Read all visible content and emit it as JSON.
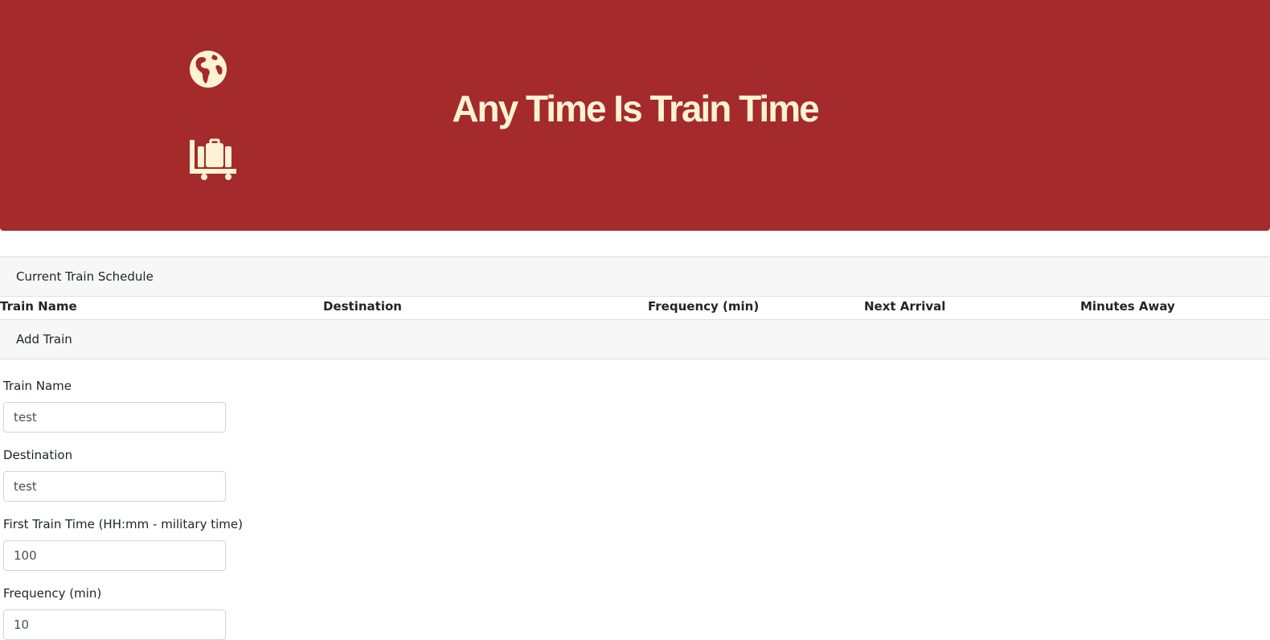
{
  "header": {
    "title": "Any Time Is Train Time",
    "icons": [
      "globe-icon",
      "luggage-cart-icon"
    ],
    "colors": {
      "background": "#a52a2c",
      "foreground": "#fdf3d4"
    }
  },
  "schedule": {
    "header": "Current Train Schedule",
    "columns": [
      "Train Name",
      "Destination",
      "Frequency (min)",
      "Next Arrival",
      "Minutes Away"
    ],
    "rows": []
  },
  "add_train": {
    "header": "Add Train",
    "fields": [
      {
        "label": "Train Name",
        "value": "test"
      },
      {
        "label": "Destination",
        "value": "test"
      },
      {
        "label": "First Train Time (HH:mm - military time)",
        "value": "100"
      },
      {
        "label": "Frequency (min)",
        "value": "10"
      }
    ]
  }
}
